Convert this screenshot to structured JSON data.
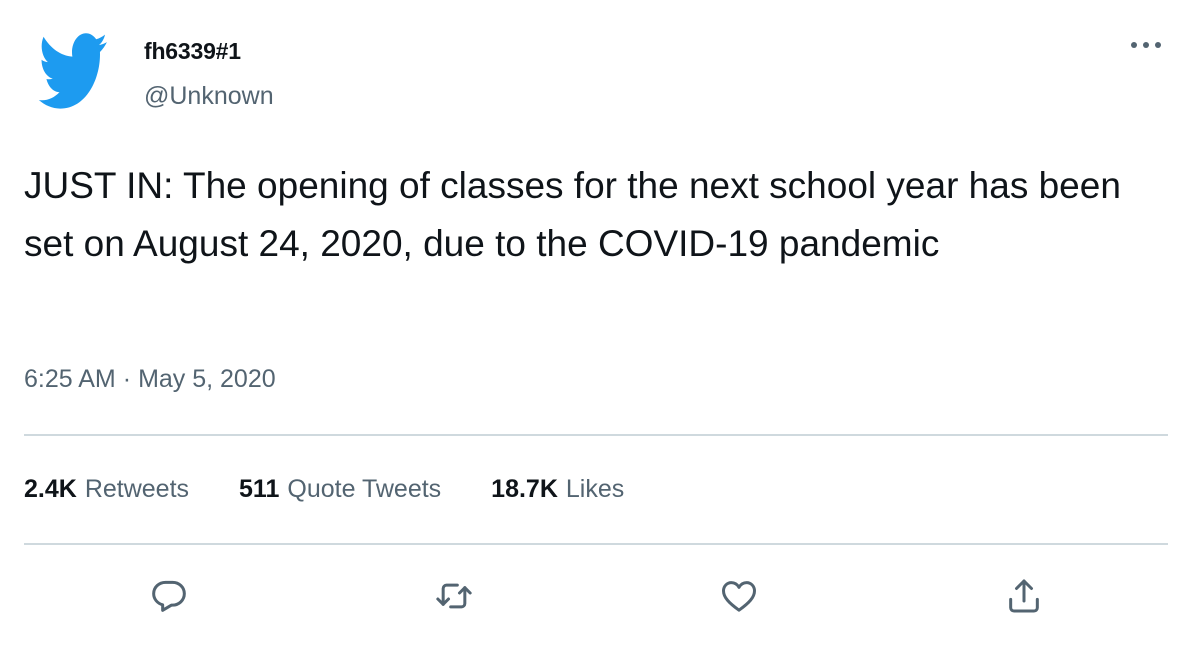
{
  "tweet": {
    "display_name": "fh6339#1",
    "handle": "@Unknown",
    "text": "JUST IN: The opening of classes for the next school year has been set on August 24, 2020, due to the COVID-19 pandemic",
    "time": "6:25 AM",
    "separator": "·",
    "date": "May 5, 2020"
  },
  "stats": {
    "retweets": {
      "count": "2.4K",
      "label": "Retweets"
    },
    "quotes": {
      "count": "511",
      "label": "Quote Tweets"
    },
    "likes": {
      "count": "18.7K",
      "label": "Likes"
    }
  },
  "icons": {
    "avatar": "twitter-bird-icon",
    "more": "more-horizontal-icon",
    "reply": "reply-icon",
    "retweet": "retweet-icon",
    "like": "heart-icon",
    "share": "share-icon"
  },
  "colors": {
    "brand": "#1d9bf0",
    "text": "#0f1419",
    "muted": "#536471",
    "divider": "#cfd9de"
  }
}
